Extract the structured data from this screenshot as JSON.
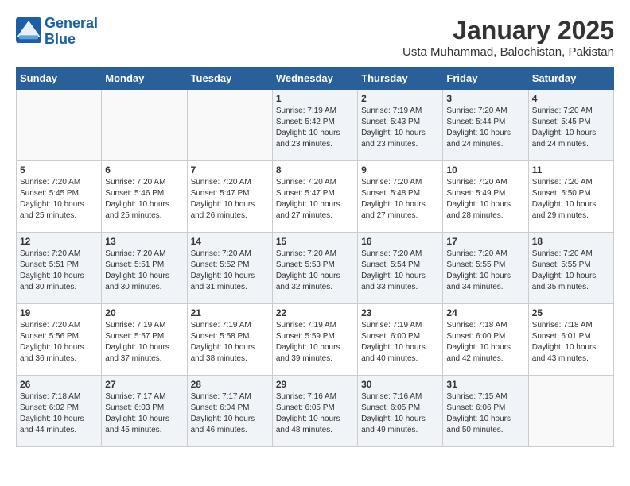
{
  "header": {
    "logo_line1": "General",
    "logo_line2": "Blue",
    "title": "January 2025",
    "subtitle": "Usta Muhammad, Balochistan, Pakistan"
  },
  "days_of_week": [
    "Sunday",
    "Monday",
    "Tuesday",
    "Wednesday",
    "Thursday",
    "Friday",
    "Saturday"
  ],
  "weeks": [
    [
      {
        "day": "",
        "sunrise": "",
        "sunset": "",
        "daylight": ""
      },
      {
        "day": "",
        "sunrise": "",
        "sunset": "",
        "daylight": ""
      },
      {
        "day": "",
        "sunrise": "",
        "sunset": "",
        "daylight": ""
      },
      {
        "day": "1",
        "sunrise": "Sunrise: 7:19 AM",
        "sunset": "Sunset: 5:42 PM",
        "daylight": "Daylight: 10 hours and 23 minutes."
      },
      {
        "day": "2",
        "sunrise": "Sunrise: 7:19 AM",
        "sunset": "Sunset: 5:43 PM",
        "daylight": "Daylight: 10 hours and 23 minutes."
      },
      {
        "day": "3",
        "sunrise": "Sunrise: 7:20 AM",
        "sunset": "Sunset: 5:44 PM",
        "daylight": "Daylight: 10 hours and 24 minutes."
      },
      {
        "day": "4",
        "sunrise": "Sunrise: 7:20 AM",
        "sunset": "Sunset: 5:45 PM",
        "daylight": "Daylight: 10 hours and 24 minutes."
      }
    ],
    [
      {
        "day": "5",
        "sunrise": "Sunrise: 7:20 AM",
        "sunset": "Sunset: 5:45 PM",
        "daylight": "Daylight: 10 hours and 25 minutes."
      },
      {
        "day": "6",
        "sunrise": "Sunrise: 7:20 AM",
        "sunset": "Sunset: 5:46 PM",
        "daylight": "Daylight: 10 hours and 25 minutes."
      },
      {
        "day": "7",
        "sunrise": "Sunrise: 7:20 AM",
        "sunset": "Sunset: 5:47 PM",
        "daylight": "Daylight: 10 hours and 26 minutes."
      },
      {
        "day": "8",
        "sunrise": "Sunrise: 7:20 AM",
        "sunset": "Sunset: 5:47 PM",
        "daylight": "Daylight: 10 hours and 27 minutes."
      },
      {
        "day": "9",
        "sunrise": "Sunrise: 7:20 AM",
        "sunset": "Sunset: 5:48 PM",
        "daylight": "Daylight: 10 hours and 27 minutes."
      },
      {
        "day": "10",
        "sunrise": "Sunrise: 7:20 AM",
        "sunset": "Sunset: 5:49 PM",
        "daylight": "Daylight: 10 hours and 28 minutes."
      },
      {
        "day": "11",
        "sunrise": "Sunrise: 7:20 AM",
        "sunset": "Sunset: 5:50 PM",
        "daylight": "Daylight: 10 hours and 29 minutes."
      }
    ],
    [
      {
        "day": "12",
        "sunrise": "Sunrise: 7:20 AM",
        "sunset": "Sunset: 5:51 PM",
        "daylight": "Daylight: 10 hours and 30 minutes."
      },
      {
        "day": "13",
        "sunrise": "Sunrise: 7:20 AM",
        "sunset": "Sunset: 5:51 PM",
        "daylight": "Daylight: 10 hours and 30 minutes."
      },
      {
        "day": "14",
        "sunrise": "Sunrise: 7:20 AM",
        "sunset": "Sunset: 5:52 PM",
        "daylight": "Daylight: 10 hours and 31 minutes."
      },
      {
        "day": "15",
        "sunrise": "Sunrise: 7:20 AM",
        "sunset": "Sunset: 5:53 PM",
        "daylight": "Daylight: 10 hours and 32 minutes."
      },
      {
        "day": "16",
        "sunrise": "Sunrise: 7:20 AM",
        "sunset": "Sunset: 5:54 PM",
        "daylight": "Daylight: 10 hours and 33 minutes."
      },
      {
        "day": "17",
        "sunrise": "Sunrise: 7:20 AM",
        "sunset": "Sunset: 5:55 PM",
        "daylight": "Daylight: 10 hours and 34 minutes."
      },
      {
        "day": "18",
        "sunrise": "Sunrise: 7:20 AM",
        "sunset": "Sunset: 5:55 PM",
        "daylight": "Daylight: 10 hours and 35 minutes."
      }
    ],
    [
      {
        "day": "19",
        "sunrise": "Sunrise: 7:20 AM",
        "sunset": "Sunset: 5:56 PM",
        "daylight": "Daylight: 10 hours and 36 minutes."
      },
      {
        "day": "20",
        "sunrise": "Sunrise: 7:19 AM",
        "sunset": "Sunset: 5:57 PM",
        "daylight": "Daylight: 10 hours and 37 minutes."
      },
      {
        "day": "21",
        "sunrise": "Sunrise: 7:19 AM",
        "sunset": "Sunset: 5:58 PM",
        "daylight": "Daylight: 10 hours and 38 minutes."
      },
      {
        "day": "22",
        "sunrise": "Sunrise: 7:19 AM",
        "sunset": "Sunset: 5:59 PM",
        "daylight": "Daylight: 10 hours and 39 minutes."
      },
      {
        "day": "23",
        "sunrise": "Sunrise: 7:19 AM",
        "sunset": "Sunset: 6:00 PM",
        "daylight": "Daylight: 10 hours and 40 minutes."
      },
      {
        "day": "24",
        "sunrise": "Sunrise: 7:18 AM",
        "sunset": "Sunset: 6:00 PM",
        "daylight": "Daylight: 10 hours and 42 minutes."
      },
      {
        "day": "25",
        "sunrise": "Sunrise: 7:18 AM",
        "sunset": "Sunset: 6:01 PM",
        "daylight": "Daylight: 10 hours and 43 minutes."
      }
    ],
    [
      {
        "day": "26",
        "sunrise": "Sunrise: 7:18 AM",
        "sunset": "Sunset: 6:02 PM",
        "daylight": "Daylight: 10 hours and 44 minutes."
      },
      {
        "day": "27",
        "sunrise": "Sunrise: 7:17 AM",
        "sunset": "Sunset: 6:03 PM",
        "daylight": "Daylight: 10 hours and 45 minutes."
      },
      {
        "day": "28",
        "sunrise": "Sunrise: 7:17 AM",
        "sunset": "Sunset: 6:04 PM",
        "daylight": "Daylight: 10 hours and 46 minutes."
      },
      {
        "day": "29",
        "sunrise": "Sunrise: 7:16 AM",
        "sunset": "Sunset: 6:05 PM",
        "daylight": "Daylight: 10 hours and 48 minutes."
      },
      {
        "day": "30",
        "sunrise": "Sunrise: 7:16 AM",
        "sunset": "Sunset: 6:05 PM",
        "daylight": "Daylight: 10 hours and 49 minutes."
      },
      {
        "day": "31",
        "sunrise": "Sunrise: 7:15 AM",
        "sunset": "Sunset: 6:06 PM",
        "daylight": "Daylight: 10 hours and 50 minutes."
      },
      {
        "day": "",
        "sunrise": "",
        "sunset": "",
        "daylight": ""
      }
    ]
  ]
}
